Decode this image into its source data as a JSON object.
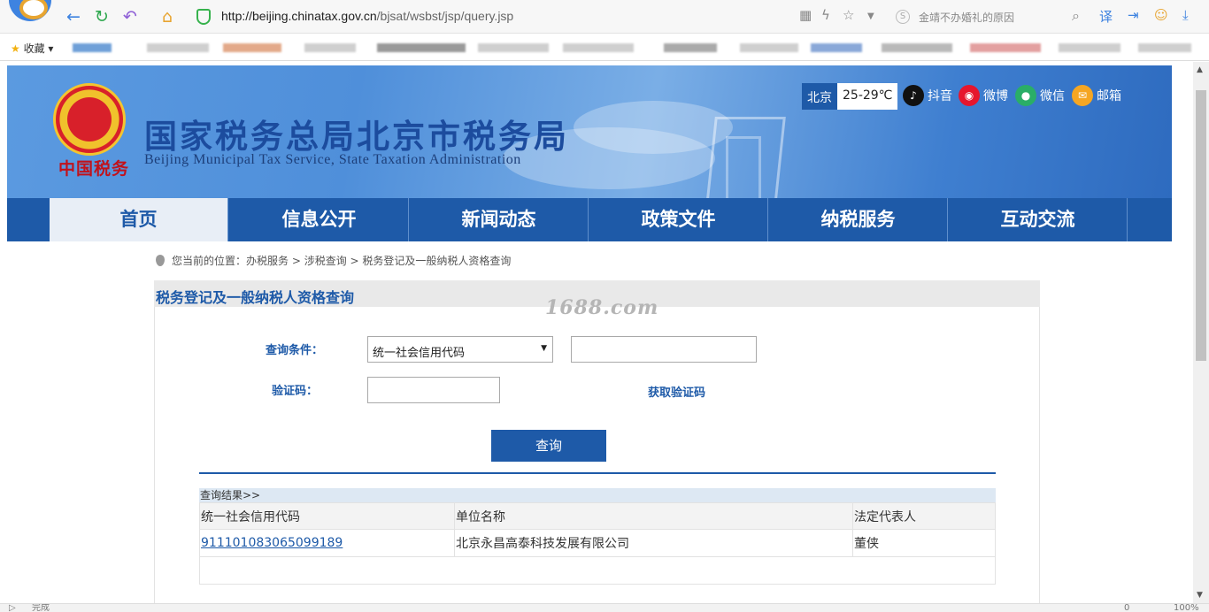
{
  "browser": {
    "url_host": "http://beijing.chinatax.gov.cn",
    "url_path": "/bjsat/wsbst/jsp/query.jsp",
    "search_placeholder": "金靖不办婚礼的原因",
    "favorites_label": "收藏",
    "status_text": "完成",
    "zoom": "100%",
    "counter": "0"
  },
  "site": {
    "title_cn": "国家税务总局北京市税务局",
    "title_en": "Beijing Municipal Tax Service, State Taxation Administration",
    "emblem_text": "中国税务",
    "weather_city": "北京",
    "weather_temp": "25-29℃",
    "social": [
      {
        "label": "抖音",
        "icon": "douyin-icon",
        "color": "#111111"
      },
      {
        "label": "微博",
        "icon": "weibo-icon",
        "color": "#e6162d"
      },
      {
        "label": "微信",
        "icon": "wechat-icon",
        "color": "#2aae67"
      },
      {
        "label": "邮箱",
        "icon": "mail-icon",
        "color": "#f5a623"
      }
    ],
    "nav": [
      "首页",
      "信息公开",
      "新闻动态",
      "政策文件",
      "纳税服务",
      "互动交流"
    ]
  },
  "breadcrumb": {
    "prefix": "您当前的位置：",
    "path": [
      "办税服务",
      "涉税查询",
      "税务登记及一般纳税人资格查询"
    ]
  },
  "watermark": "1688.com",
  "query": {
    "title": "税务登记及一般纳税人资格查询",
    "condition_label": "查询条件：",
    "condition_selected": "统一社会信用代码",
    "captcha_label": "验证码：",
    "get_captcha": "获取验证码",
    "submit": "查询"
  },
  "result": {
    "heading": "查询结果>>",
    "columns": [
      "统一社会信用代码",
      "单位名称",
      "法定代表人"
    ],
    "rows": [
      [
        "911101083065099189",
        "北京永昌高泰科技发展有限公司",
        "董侠"
      ]
    ]
  },
  "colors": {
    "brand_blue": "#1e5aa8",
    "title_blue": "#1c4c9e"
  }
}
